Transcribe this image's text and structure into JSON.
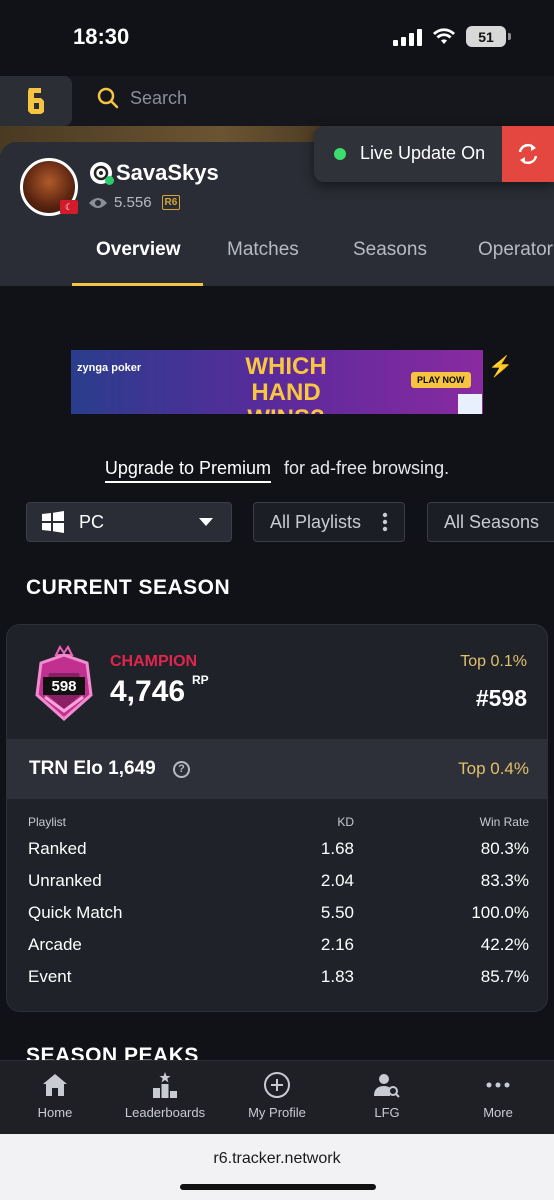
{
  "status": {
    "time": "18:30",
    "battery": "51"
  },
  "topnav": {
    "search_placeholder": "Search"
  },
  "profile": {
    "username": "SavaSkys",
    "views": "5.556",
    "game_badge": "R6",
    "tabs": [
      {
        "label": "Overview"
      },
      {
        "label": "Matches"
      },
      {
        "label": "Seasons"
      },
      {
        "label": "Operator"
      }
    ]
  },
  "live_update": {
    "label": "Live Update On"
  },
  "ad": {
    "brand": "zynga poker",
    "headline": "WHICH HAND WINS?",
    "cta": "PLAY NOW"
  },
  "premium": {
    "link": "Upgrade to Premium",
    "text": "for ad-free browsing."
  },
  "filters": {
    "platform": "PC",
    "playlists": "All Playlists",
    "seasons": "All Seasons"
  },
  "current_season": {
    "title": "CURRENT SEASON",
    "rank_number": "598",
    "rank_name": "CHAMPION",
    "rp": "4,746",
    "rp_unit": "RP",
    "top_percent": "Top 0.1%",
    "position": "#598",
    "elo_label": "TRN Elo 1,649",
    "elo_help": "?",
    "elo_top": "Top 0.4%",
    "headers": {
      "playlist": "Playlist",
      "kd": "KD",
      "win_rate": "Win Rate"
    },
    "rows": [
      {
        "playlist": "Ranked",
        "kd": "1.68",
        "win_rate": "80.3%"
      },
      {
        "playlist": "Unranked",
        "kd": "2.04",
        "win_rate": "83.3%"
      },
      {
        "playlist": "Quick Match",
        "kd": "5.50",
        "win_rate": "100.0%"
      },
      {
        "playlist": "Arcade",
        "kd": "2.16",
        "win_rate": "42.2%"
      },
      {
        "playlist": "Event",
        "kd": "1.83",
        "win_rate": "85.7%"
      }
    ]
  },
  "season_peaks": {
    "title": "SEASON PEAKS"
  },
  "bottom_nav": [
    {
      "label": "Home",
      "icon": "home-icon"
    },
    {
      "label": "Leaderboards",
      "icon": "leaderboard-icon"
    },
    {
      "label": "My Profile",
      "icon": "add-circle-icon"
    },
    {
      "label": "LFG",
      "icon": "user-search-icon"
    },
    {
      "label": "More",
      "icon": "more-icon"
    }
  ],
  "browser": {
    "url": "r6.tracker.network"
  },
  "colors": {
    "accent": "#f5c542",
    "champion": "#e0254e",
    "gold_text": "#e0c06a",
    "live_red": "#e3473f"
  }
}
